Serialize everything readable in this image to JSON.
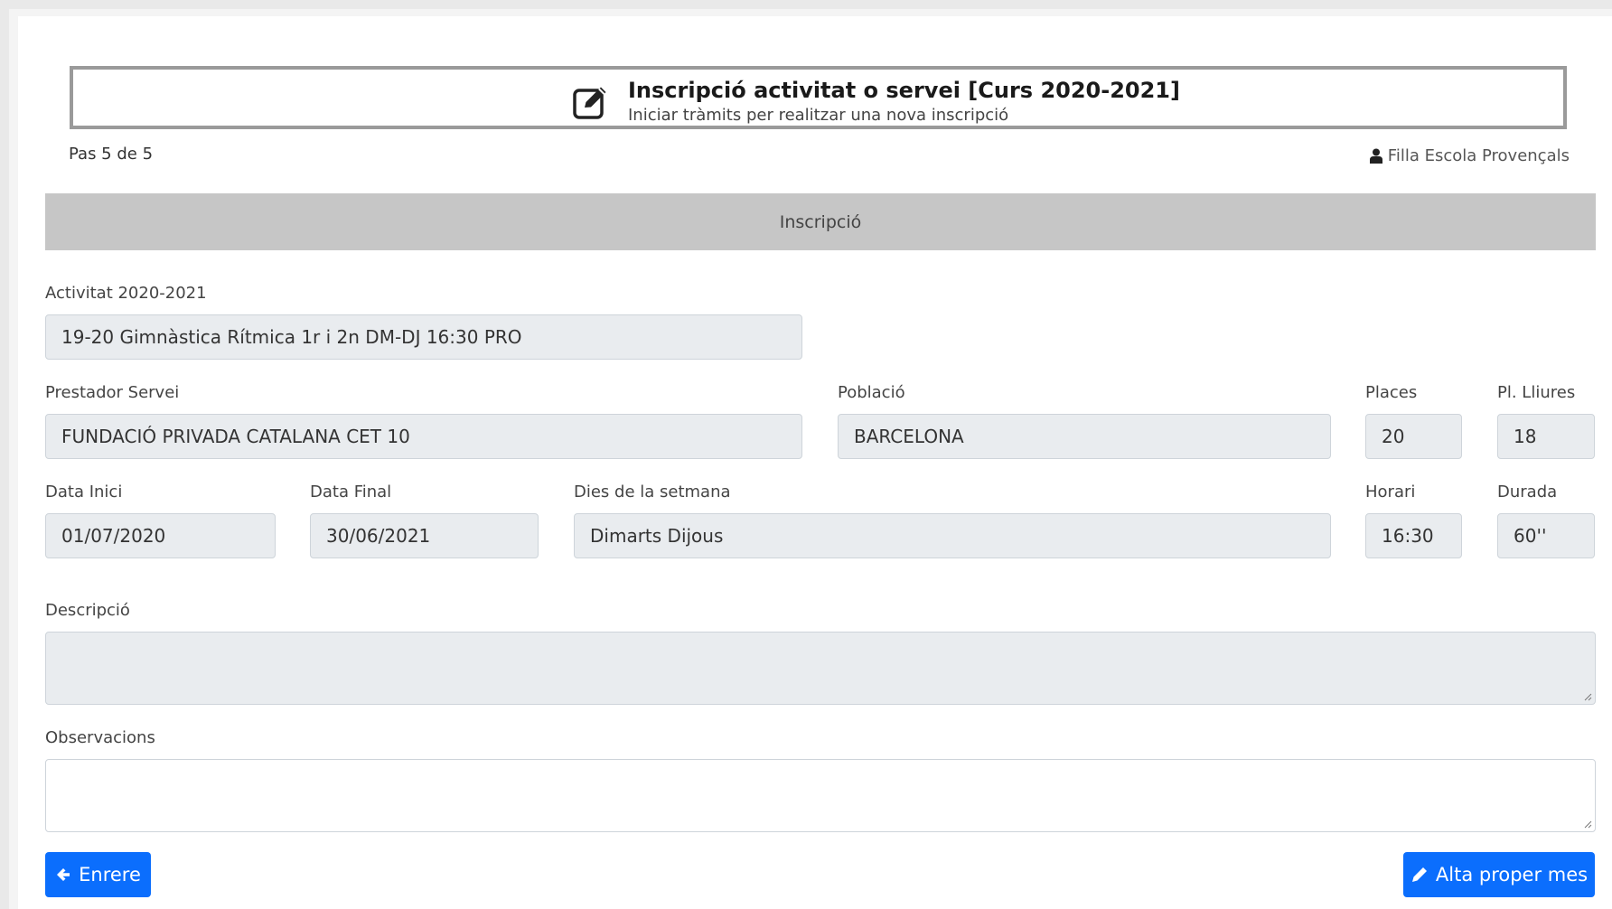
{
  "header": {
    "title": "Inscripció activitat o servei [Curs 2020-2021]",
    "subtitle": "Iniciar tràmits per realitzar una nova inscripció",
    "icon": "edit-icon"
  },
  "step": "Pas 5 de 5",
  "user": {
    "name": "Filla Escola Provençals",
    "icon": "user-icon"
  },
  "section": {
    "title": "Inscripció"
  },
  "form": {
    "activitat": {
      "label": "Activitat  2020-2021",
      "value": "19-20 Gimnàstica Rítmica 1r i 2n DM-DJ 16:30 PRO"
    },
    "prestador": {
      "label": "Prestador Servei",
      "value": "FUNDACIÓ PRIVADA CATALANA CET 10"
    },
    "poblacio": {
      "label": "Població",
      "value": "BARCELONA"
    },
    "places": {
      "label": "Places",
      "value": "20"
    },
    "lliures": {
      "label": "Pl. Lliures",
      "value": "18"
    },
    "data_inici": {
      "label": "Data Inici",
      "value": "01/07/2020"
    },
    "data_final": {
      "label": "Data Final",
      "value": "30/06/2021"
    },
    "dies": {
      "label": "Dies de la setmana",
      "value": "Dimarts Dijous"
    },
    "horari": {
      "label": "Horari",
      "value": "16:30"
    },
    "durada": {
      "label": "Durada",
      "value": "60''"
    },
    "descripcio": {
      "label": "Descripció",
      "value": ""
    },
    "observacions": {
      "label": "Observacions",
      "value": ""
    }
  },
  "buttons": {
    "back": {
      "label": "Enrere",
      "icon": "arrow-left-icon"
    },
    "submit": {
      "label": "Alta proper mes",
      "icon": "pencil-icon"
    }
  },
  "colors": {
    "primary": "#0b6efd",
    "section_bar": "#c6c6c6",
    "readonly_field": "#e9ecef"
  }
}
